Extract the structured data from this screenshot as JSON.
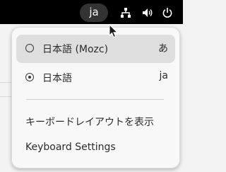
{
  "panel": {
    "input_indicator": "ja",
    "icons": [
      "network-icon",
      "volume-icon",
      "power-icon"
    ]
  },
  "menu": {
    "items": [
      {
        "label": "日本語 (Mozc)",
        "hint": "あ",
        "selected": false,
        "highlighted": true
      },
      {
        "label": "日本語",
        "hint": "ja",
        "selected": true,
        "highlighted": false
      }
    ],
    "keyboard_layout_label": "キーボードレイアウトを表示",
    "keyboard_settings_label": "Keyboard Settings"
  },
  "colors": {
    "panel_bg": "#000000",
    "menu_bg": "#f8f8f8",
    "hover_bg": "#dedede",
    "text": "#2b2b2b"
  }
}
